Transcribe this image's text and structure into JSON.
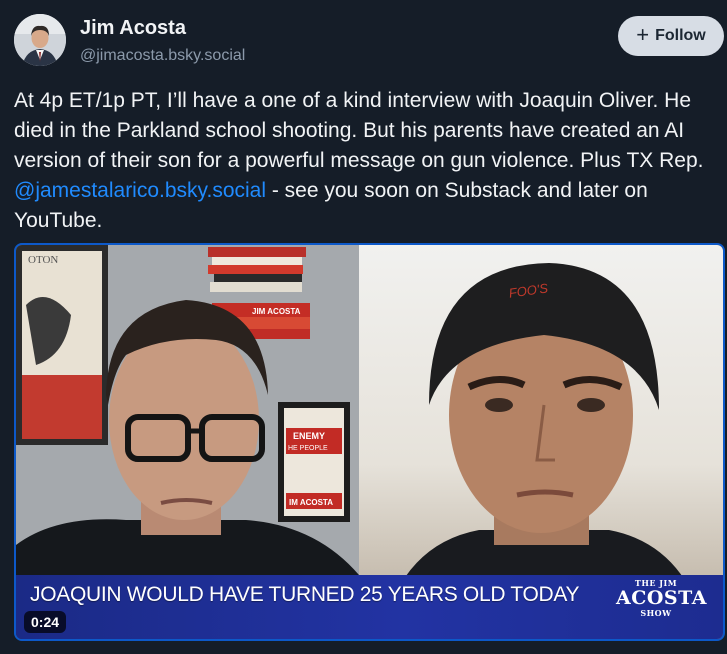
{
  "post": {
    "author": {
      "display_name": "Jim Acosta",
      "handle": "@jimacosta.bsky.social"
    },
    "follow_button": {
      "icon": "plus-icon",
      "label": "Follow"
    },
    "text": {
      "part1": "At 4p ET/1p PT, I’ll have a one of a kind interview with Joaquin Oliver. He died in the Parkland school shooting. But his parents have created an AI version of their son for a powerful message on gun violence. Plus TX Rep. ",
      "mention": "@jamestalarico.bsky.social",
      "part2": " - see you soon on Substack and later on YouTube."
    },
    "video": {
      "headline": "JOAQUIN WOULD HAVE TURNED 25 YEARS OLD TODAY",
      "logo": {
        "line1": "THE JIM",
        "line2": "ACOSTA",
        "line3": "SHOW"
      },
      "duration": "0:24",
      "set_text": {
        "poster_top": "OTON",
        "book_spine": "JIM ACOSTA",
        "book_cover_line1": "ENEMY",
        "book_cover_line2": "HE PEOPLE",
        "book_cover_author": "IM ACOSTA",
        "beanie_text": "FOO'S"
      }
    },
    "colors": {
      "background": "#151d28",
      "link": "#208bfe",
      "follow_bg": "#d7dde5",
      "lower_third": "#2233a3",
      "video_border": "#0d59c9"
    }
  }
}
